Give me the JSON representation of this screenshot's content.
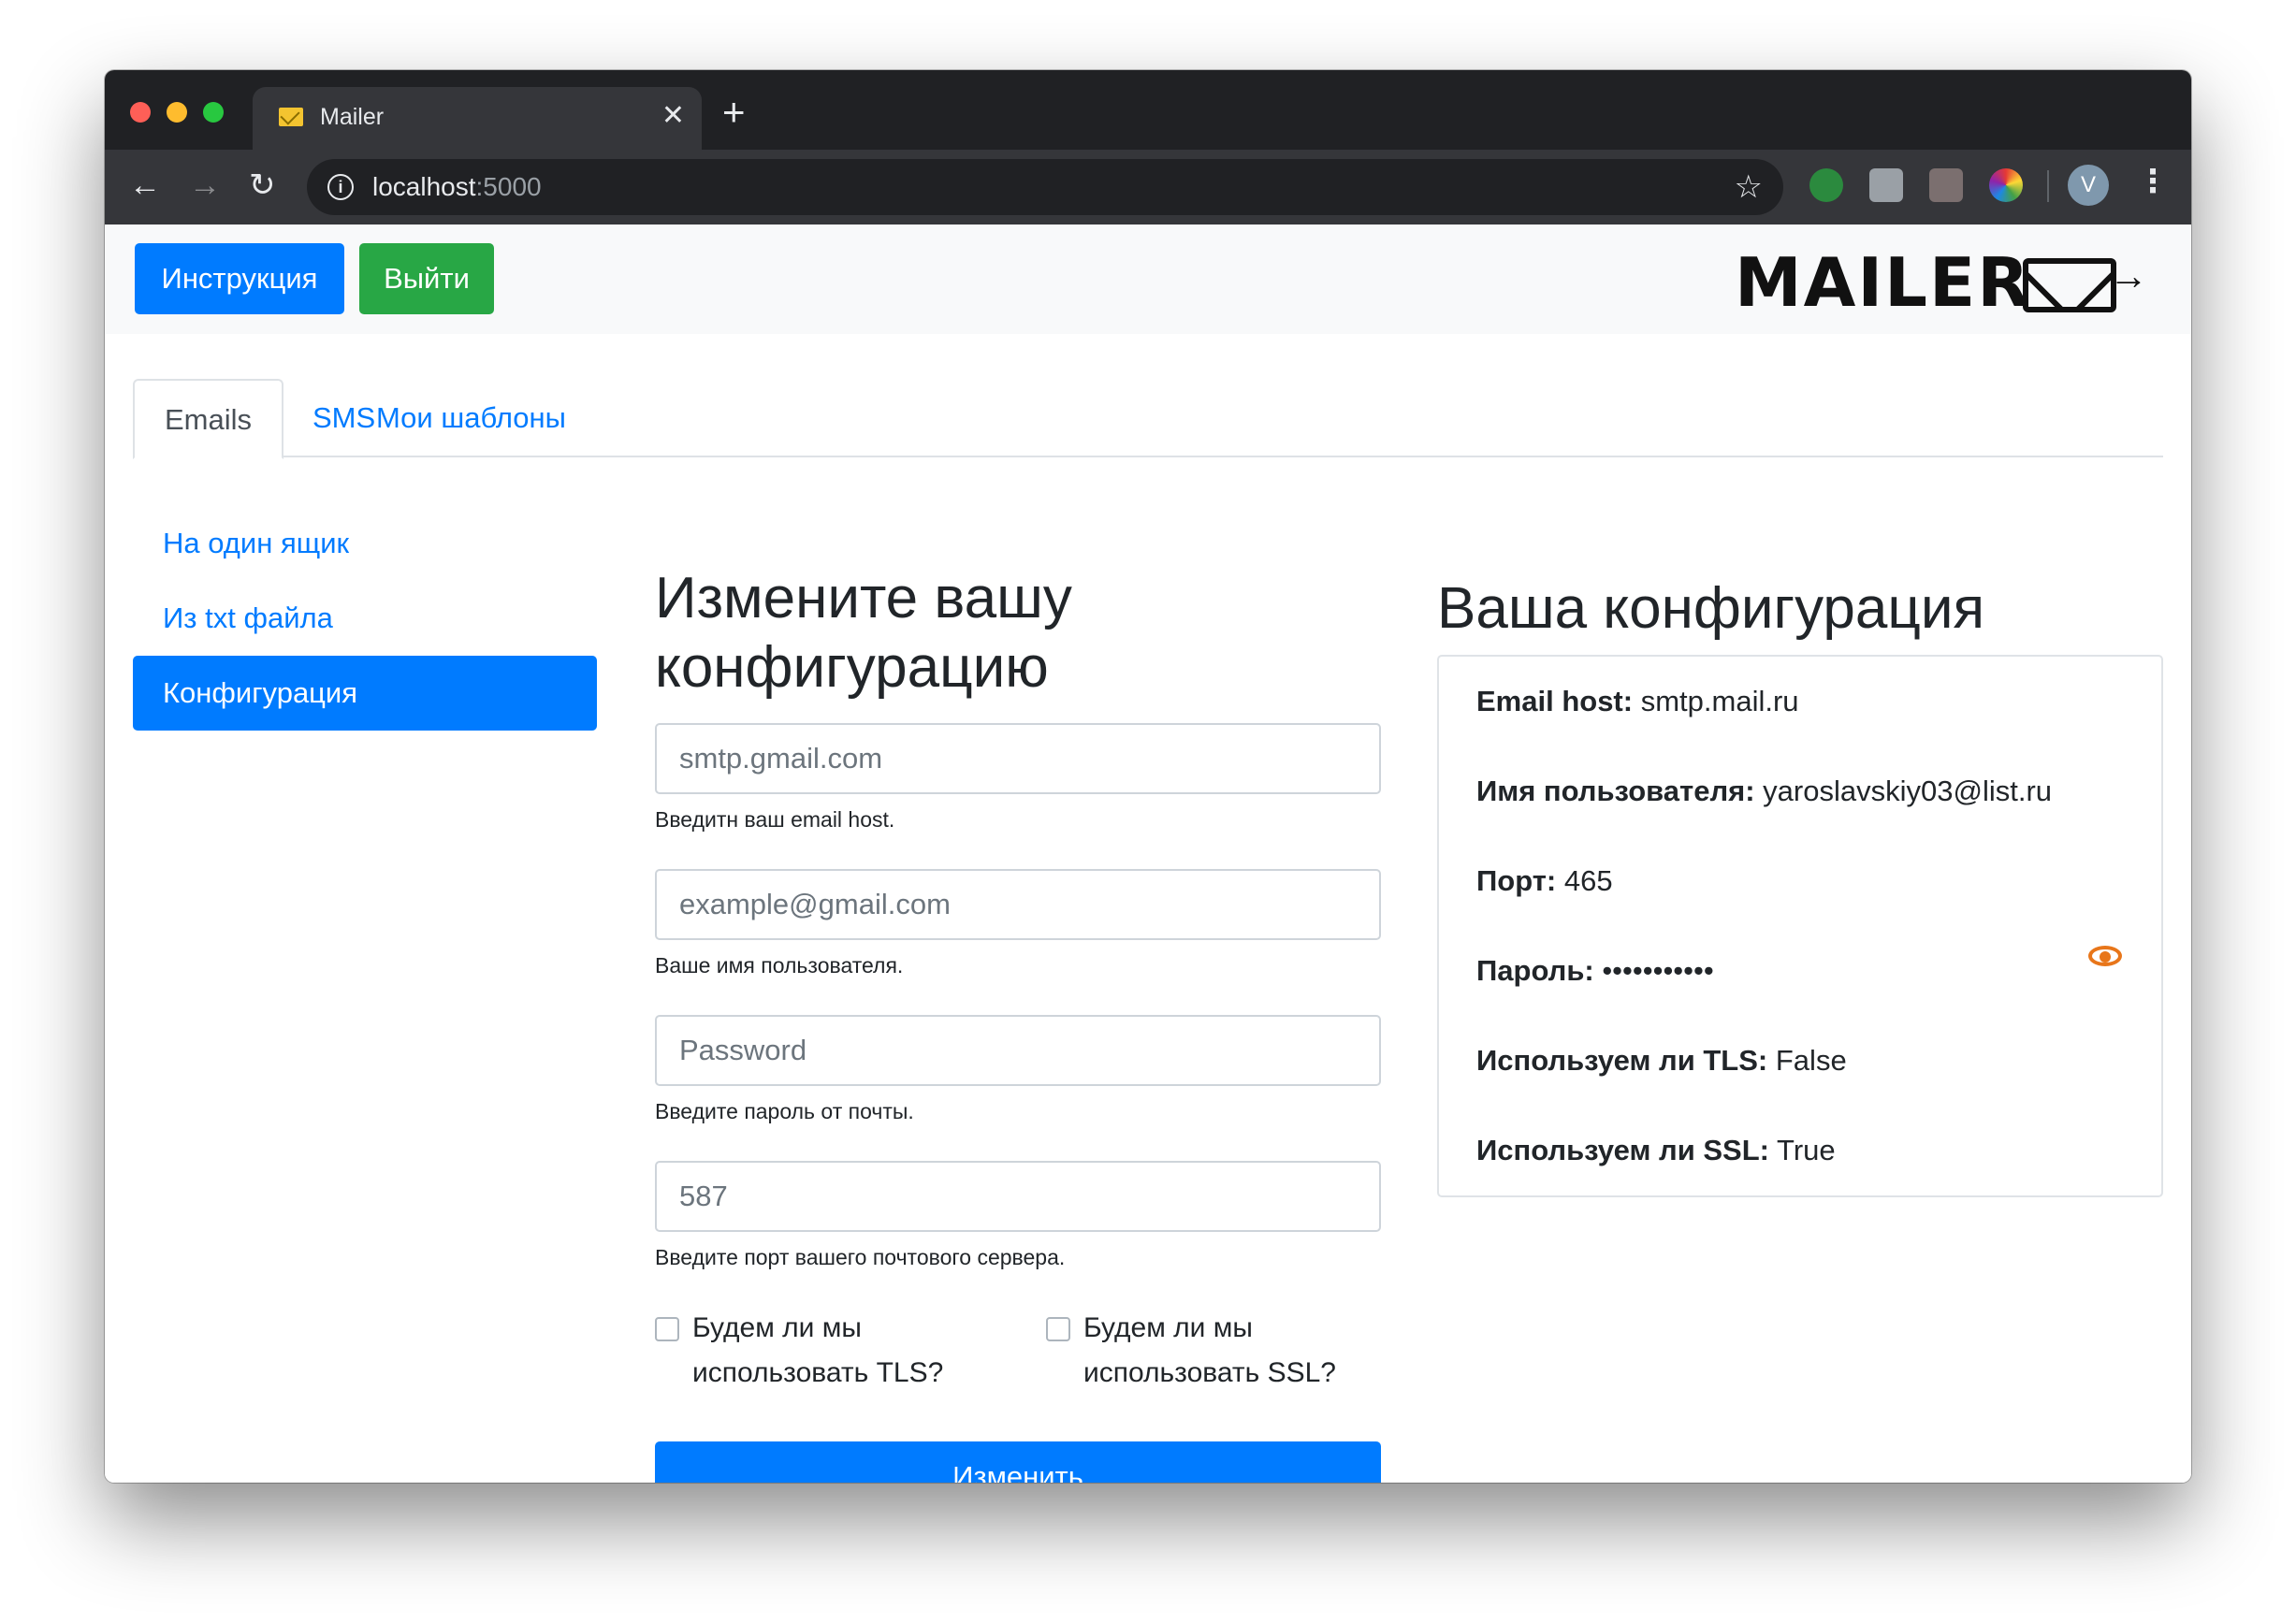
{
  "browser": {
    "tab_title": "Mailer",
    "tab_close": "✕",
    "new_tab": "+",
    "url_host": "localhost",
    "url_port": ":5000",
    "avatar_letter": "V"
  },
  "navbar": {
    "instruction_label": "Инструкция",
    "logout_label": "Выйти",
    "logo_text": "MAILER"
  },
  "tabs": [
    {
      "label": "Emails"
    },
    {
      "label": "SMS"
    },
    {
      "label": "Мои шаблоны"
    }
  ],
  "sidebar": {
    "items": [
      {
        "label": "На один ящик"
      },
      {
        "label": "Из txt файла"
      },
      {
        "label": "Конфигурация"
      }
    ]
  },
  "form": {
    "heading_line1": "Измените вашу",
    "heading_line2": "конфигурацию",
    "host_placeholder": "smtp.gmail.com",
    "host_help": "Введитн ваш email host.",
    "user_placeholder": "example@gmail.com",
    "user_help": "Ваше имя пользователя.",
    "password_placeholder": "Password",
    "password_help": "Введите пароль от почты.",
    "port_placeholder": "587",
    "port_help": "Введите порт вашего почтового сервера.",
    "tls_line1": "Будем ли мы",
    "tls_line2": "использовать TLS?",
    "ssl_line1": "Будем ли мы",
    "ssl_line2": "использовать SSL?",
    "submit_label": "Изменить"
  },
  "config": {
    "heading": "Ваша конфигурация",
    "host_label": "Email host:",
    "host_value": "smtp.mail.ru",
    "user_label": "Имя пользователя:",
    "user_value": "yaroslavskiy03@list.ru",
    "port_label": "Порт:",
    "port_value": "465",
    "password_label": "Пароль:",
    "password_value": "•••••••••••",
    "tls_label": "Используем ли TLS:",
    "tls_value": "False",
    "ssl_label": "Используем ли SSL:",
    "ssl_value": "True"
  },
  "colors": {
    "primary": "#007bff",
    "success": "#28a745",
    "eye_icon": "#e8761a"
  }
}
